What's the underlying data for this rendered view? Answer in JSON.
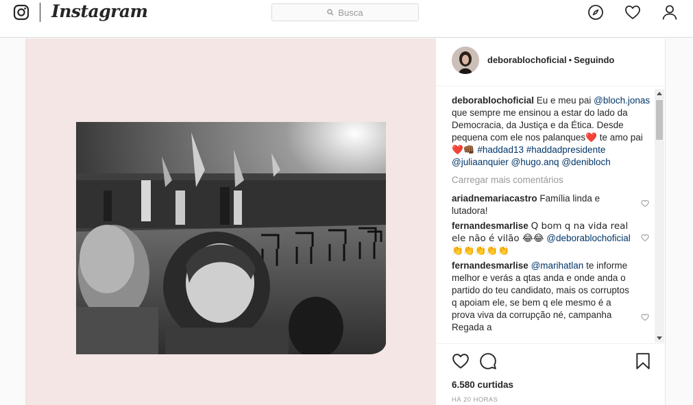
{
  "nav": {
    "brand": "Instagram",
    "search_placeholder": "Busca",
    "icons": [
      "instagram-glyph-icon",
      "compass-icon",
      "heart-icon",
      "user-icon"
    ]
  },
  "post": {
    "author": "deborablochoficial",
    "follow_status": "Seguindo",
    "caption": {
      "username": "deborablochoficial",
      "text_1": "Eu e meu pai",
      "mention_1": "@bloch.jonas",
      "text_2": "que sempre me ensinou a estar do lado da Democracia, da Justiça e da Ética. Desde pequena com ele nos palanques",
      "emoji_1": "❤️",
      "text_3": "te amo pai",
      "emoji_2": "❤️👊🏾",
      "hashtag_1": "#haddad13",
      "hashtag_2": "#haddadpresidente",
      "mention_2": "@juliaanquier",
      "mention_3": "@hugo.anq",
      "mention_4": "@denibloch"
    },
    "load_more": "Carregar mais comentários",
    "comments": [
      {
        "username": "ariadnemariacastro",
        "text": "Família linda e lutadora!"
      },
      {
        "username": "fernandesmarlise",
        "text": "Q bom q na vida real ele não é vilão 😂😂",
        "mention": "@deborablochoficial",
        "emoji": "👏👏👏👏👏"
      },
      {
        "username": "fernandesmarlise",
        "mention": "@marihatlan",
        "text": "te informe melhor e verás a qtas anda e onde anda o partido do teu candidato, mais os corruptos q apoiam ele, se bem q ele mesmo é a prova viva da corrupção né, campanha Regada a"
      }
    ],
    "likes": "6.580 curtidas",
    "timestamp": "HÁ 20 HORAS",
    "colors": {
      "media_bg": "#f3e6e4",
      "link": "#003569",
      "muted": "#999999"
    }
  }
}
